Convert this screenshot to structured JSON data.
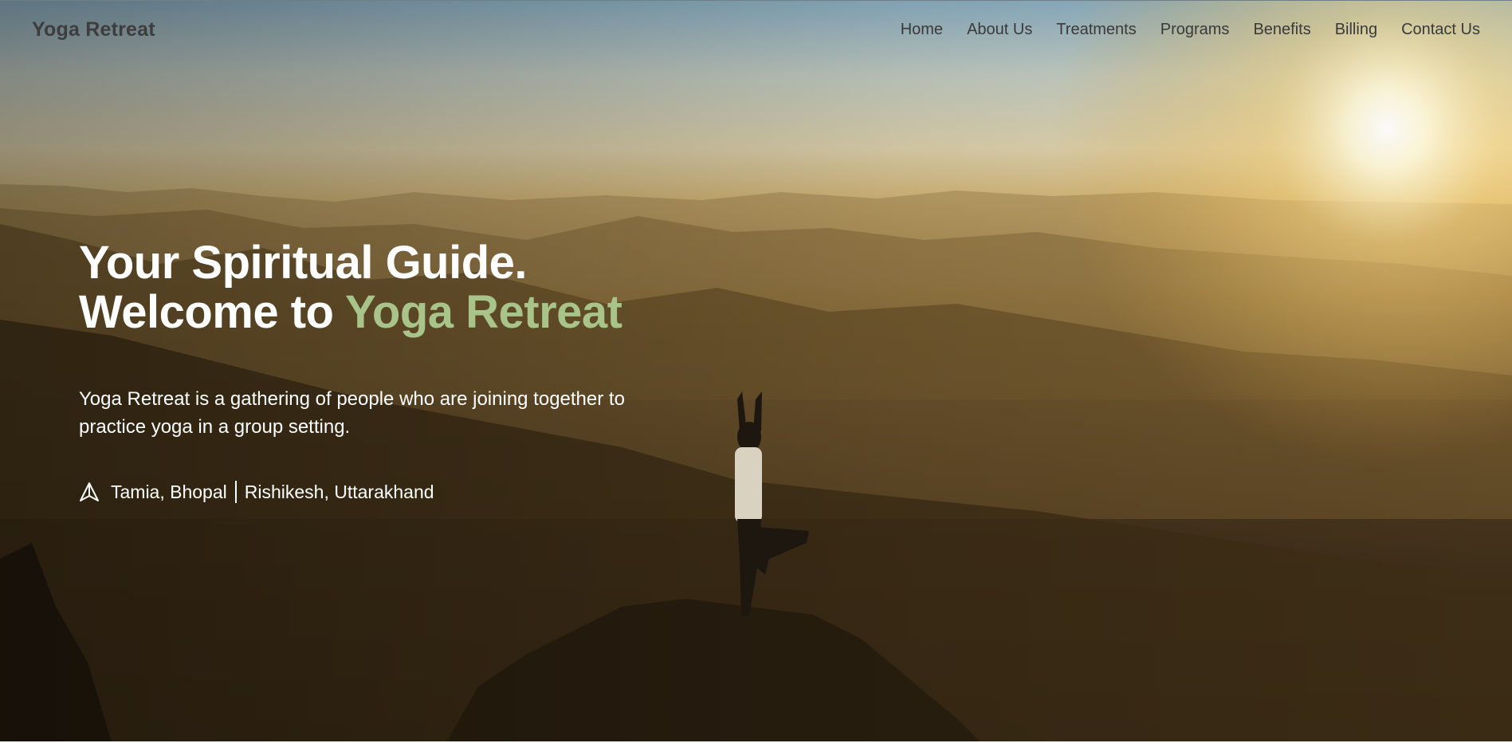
{
  "nav": {
    "brand": "Yoga Retreat",
    "links": [
      "Home",
      "About Us",
      "Treatments",
      "Programs",
      "Benefits",
      "Billing",
      "Contact Us"
    ]
  },
  "hero": {
    "headline_line1": "Your Spiritual Guide.",
    "headline_line2_prefix": "Welcome to ",
    "headline_line2_accent": "Yoga Retreat",
    "description": "Yoga Retreat is a gathering of people who are joining together to practice yoga in a group setting.",
    "location_icon": "navigation-arrow-icon",
    "location_1": "Tamia, Bhopal",
    "location_2": "Rishikesh, Uttarakhand"
  },
  "colors": {
    "accent": "#a9c48a",
    "nav_text": "#3a3a3a",
    "hero_text": "#ffffff"
  }
}
